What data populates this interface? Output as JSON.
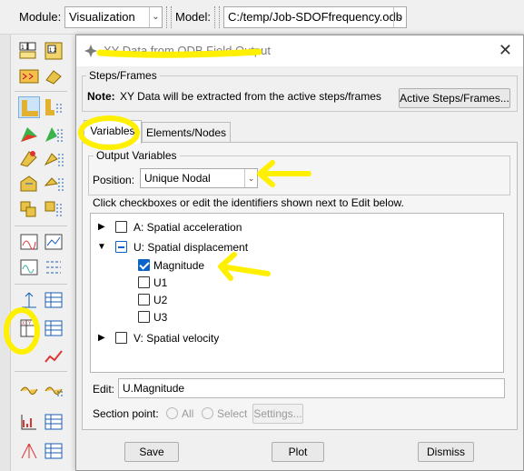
{
  "context_bar": {
    "module_label": "Module:",
    "module_value": "Visualization",
    "model_label": "Model:",
    "model_value": "C:/temp/Job-SDOFfrequency.odb"
  },
  "toolbox": {
    "icons": [
      "query-icon",
      "field-output-icon",
      "plot-undeformed-icon",
      "plot-deformed-icon",
      "plot-contours-icon",
      "plot-symbols-icon",
      "plot-material-orientation-icon",
      "allow-multiple-plots-icon",
      "animate-time-history-icon",
      "animate-scale-factor-icon",
      "xy-data-manager-icon",
      "create-xy-data-icon",
      "xy-plot-icon",
      "stream-icon",
      "view-cut-icon",
      "free-body-icon",
      "display-group-icon"
    ]
  },
  "dialog": {
    "title": "XY Data from ODB Field Output",
    "steps_group_title": "Steps/Frames",
    "note_label": "Note:",
    "note_text": "XY Data will be extracted from the active steps/frames",
    "active_steps_button": "Active Steps/Frames...",
    "tabs": [
      {
        "label": "Variables",
        "active": true
      },
      {
        "label": "Elements/Nodes",
        "active": false
      }
    ],
    "output_group_title": "Output Variables",
    "position_label": "Position:",
    "position_value": "Unique Nodal",
    "instructions": "Click checkboxes or edit the identifiers shown next to Edit below.",
    "tree": {
      "row_a": {
        "label": "A: Spatial acceleration",
        "checked": false
      },
      "row_u": {
        "label": "U: Spatial displacement",
        "checked": "partial"
      },
      "row_mag": {
        "label": "Magnitude",
        "checked": true
      },
      "row_u1": {
        "label": "U1",
        "checked": false
      },
      "row_u2": {
        "label": "U2",
        "checked": false
      },
      "row_u3": {
        "label": "U3",
        "checked": false
      },
      "row_v": {
        "label": "V: Spatial velocity",
        "checked": false
      }
    },
    "edit_label": "Edit:",
    "edit_value": "U.Magnitude",
    "section_point_label": "Section point:",
    "section_all": "All",
    "section_select": "Select",
    "settings_button": "Settings...",
    "save_button": "Save",
    "plot_button": "Plot",
    "dismiss_button": "Dismiss"
  },
  "colors": {
    "annotation_yellow": "#ffef00",
    "checkbox_blue": "#0a63c9"
  }
}
